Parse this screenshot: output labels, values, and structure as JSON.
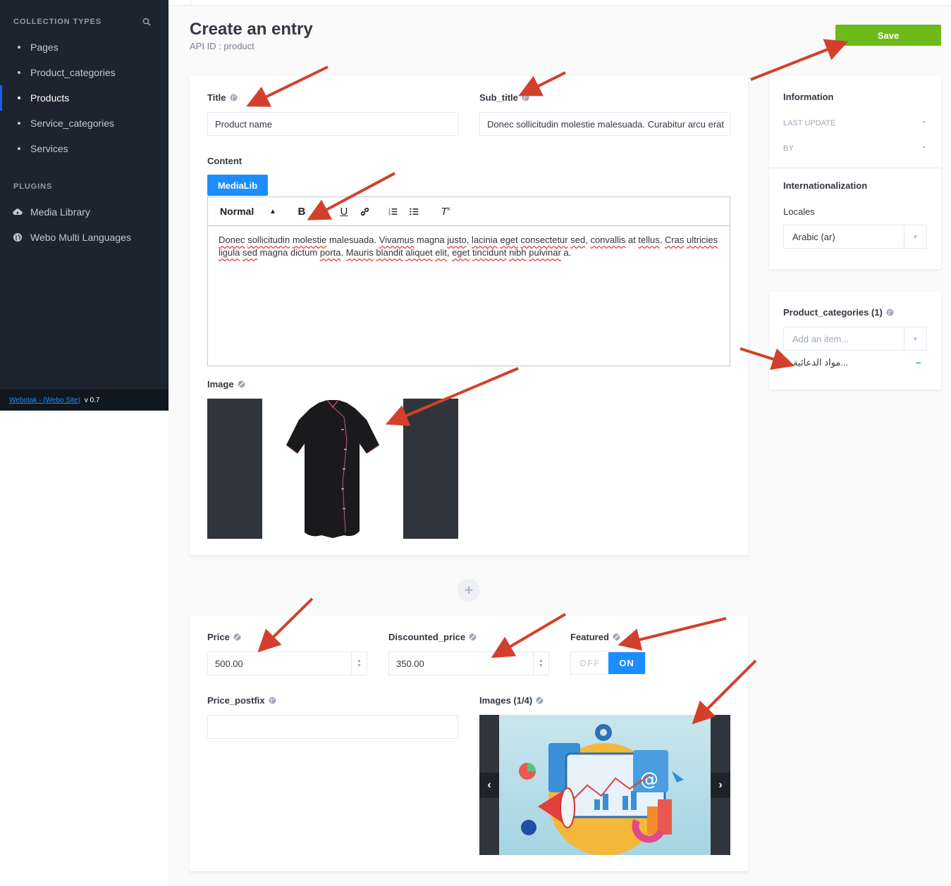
{
  "sidebar": {
    "collection_types_label": "Collection Types",
    "collection_items": [
      {
        "label": "Pages",
        "active": false
      },
      {
        "label": "Product_categories",
        "active": false
      },
      {
        "label": "Products",
        "active": true
      },
      {
        "label": "Service_categories",
        "active": false
      },
      {
        "label": "Services",
        "active": false
      }
    ],
    "plugins_label": "Plugins",
    "plugin_items": [
      {
        "label": "Media Library",
        "icon": "cloud-upload-icon"
      },
      {
        "label": "Webo Multi Languages",
        "icon": "globe-icon"
      }
    ],
    "footer": {
      "link": "Webotak - (Webo Site)",
      "version": "v 0.7"
    }
  },
  "header": {
    "title": "Create an entry",
    "api_id": "API ID : product",
    "save_label": "Save"
  },
  "form": {
    "title_label": "Title",
    "title_value": "Product name",
    "subtitle_label": "Sub_title",
    "subtitle_value": "Donec sollicitudin molestie malesuada. Curabitur arcu erat",
    "content_label": "Content",
    "medialib_label": "MediaLib",
    "editor": {
      "format": "Normal",
      "text_parts": [
        "Donec",
        " ",
        "sollicitudin",
        " ",
        "molestie",
        " malesuada. ",
        "Vivamus",
        " magna ",
        "justo",
        ", ",
        "lacinia",
        " ",
        "eget",
        " ",
        "consectetur",
        " ",
        "sed",
        ", ",
        "convallis",
        " at ",
        "tellus",
        ". ",
        "Cras",
        " ",
        "ultricies",
        " ",
        "ligula",
        " ",
        "sed",
        " magna dictum ",
        "porta",
        ". ",
        "Mauris",
        " ",
        "blandit",
        " ",
        "aliquet",
        " ",
        "elit",
        ", ",
        "eget",
        " ",
        "tincidunt",
        " ",
        "nibh",
        " ",
        "pulvinar",
        " a."
      ]
    },
    "image_label": "Image",
    "price_label": "Price",
    "price_value": "500.00",
    "discounted_label": "Discounted_price",
    "discounted_value": "350.00",
    "featured_label": "Featured",
    "featured_off": "OFF",
    "featured_on": "ON",
    "featured_value": true,
    "price_postfix_label": "Price_postfix",
    "price_postfix_value": "",
    "images_label": "Images (1/4)"
  },
  "side": {
    "information_title": "Information",
    "last_update_label": "LAST UPDATE",
    "last_update_value": "-",
    "by_label": "BY",
    "by_value": "-",
    "i18n_title": "Internationalization",
    "locales_label": "Locales",
    "locale_value": "Arabic (ar)",
    "relation_title": "Product_categories (1)",
    "relation_placeholder": "Add an item...",
    "relation_item": "...مواد الدعائية",
    "relation_remove": "–"
  },
  "colors": {
    "sidebar_bg": "#1c2430",
    "accent_blue": "#1c8dff",
    "save_green": "#6dbb1a",
    "annotation_red": "#d2402b"
  }
}
